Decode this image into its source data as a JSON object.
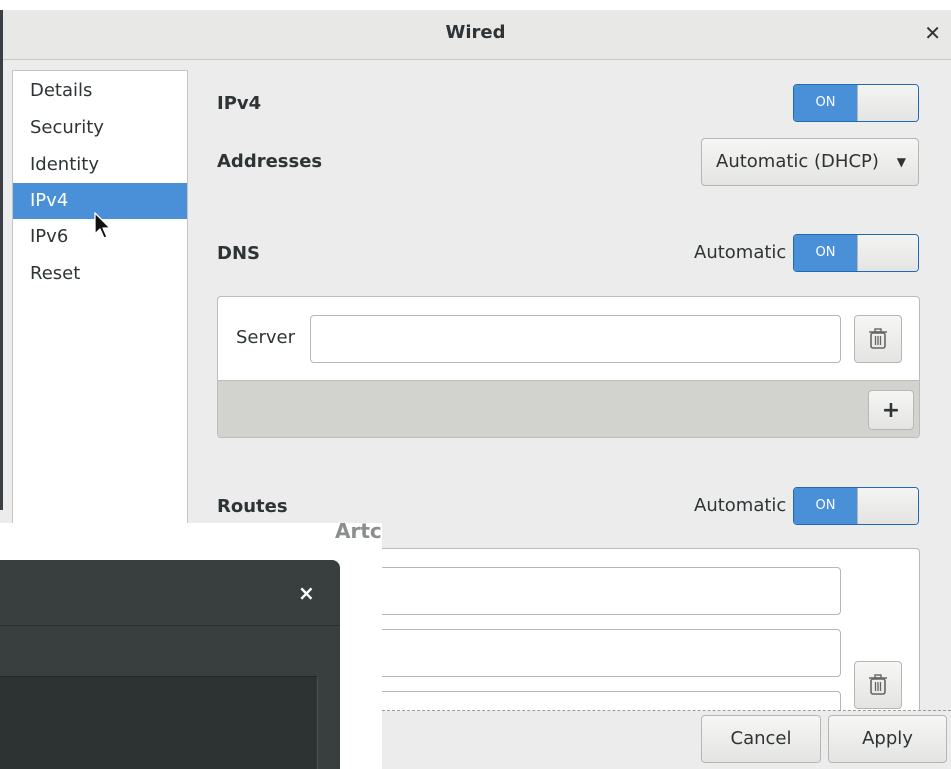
{
  "window": {
    "title": "Wired",
    "close_icon": "close-icon"
  },
  "sidebar": {
    "items": [
      {
        "label": "Details"
      },
      {
        "label": "Security"
      },
      {
        "label": "Identity"
      },
      {
        "label": "IPv4",
        "selected": true
      },
      {
        "label": "IPv6"
      },
      {
        "label": "Reset"
      }
    ]
  },
  "ipv4": {
    "label": "IPv4",
    "switch": "ON",
    "state": true
  },
  "addresses": {
    "label": "Addresses",
    "value": "Automatic (DHCP)",
    "arrow_icon": "chevron-down-icon"
  },
  "dns": {
    "label": "DNS",
    "automatic_label": "Automatic",
    "switch": "ON",
    "server_label": "Server",
    "server_value": "",
    "add_label": "+"
  },
  "routes": {
    "label": "Routes",
    "automatic_label": "Automatic",
    "switch": "ON"
  },
  "buttons": {
    "cancel": "Cancel",
    "apply": "Apply"
  },
  "overlay_window": {
    "title_fragment": "Artc",
    "close": "×"
  },
  "colors": {
    "accent": "#4a90d9",
    "dialog_bg": "#ececec",
    "overlay_bg": "#393f3f"
  }
}
